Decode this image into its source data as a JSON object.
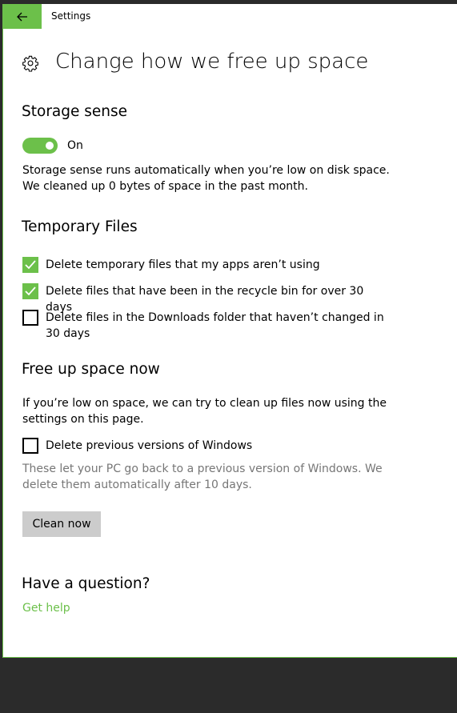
{
  "window": {
    "title": "Settings",
    "back_icon": "back-arrow-icon"
  },
  "page": {
    "title": "Change how we free up space",
    "icon": "gear-icon"
  },
  "storage_sense": {
    "heading": "Storage sense",
    "toggle_state": "on",
    "toggle_label": "On",
    "description_line1": "Storage sense runs automatically when you’re low on disk space.",
    "description_line2": "We cleaned up 0 bytes of space in the past month."
  },
  "temporary_files": {
    "heading": "Temporary Files",
    "options": [
      {
        "label": "Delete temporary files that my apps aren’t using",
        "checked": true
      },
      {
        "label": "Delete files that have been in the recycle bin for over 30 days",
        "checked": true
      },
      {
        "label": "Delete files in the Downloads folder that haven’t changed in 30 days",
        "checked": false
      }
    ]
  },
  "free_up_now": {
    "heading": "Free up space now",
    "description": "If you’re low on space, we can try to clean up files now using the settings on this page.",
    "option_label": "Delete previous versions of Windows",
    "option_checked": false,
    "option_note": "These let your PC go back to a previous version of Windows. We delete them automatically after 10 days.",
    "button_label": "Clean now"
  },
  "help": {
    "heading": "Have a question?",
    "link_label": "Get help"
  },
  "colors": {
    "accent": "#6cc04a",
    "button_bg": "#cccccc",
    "muted_text": "#767676",
    "desktop_bg": "#2b2b2b"
  }
}
